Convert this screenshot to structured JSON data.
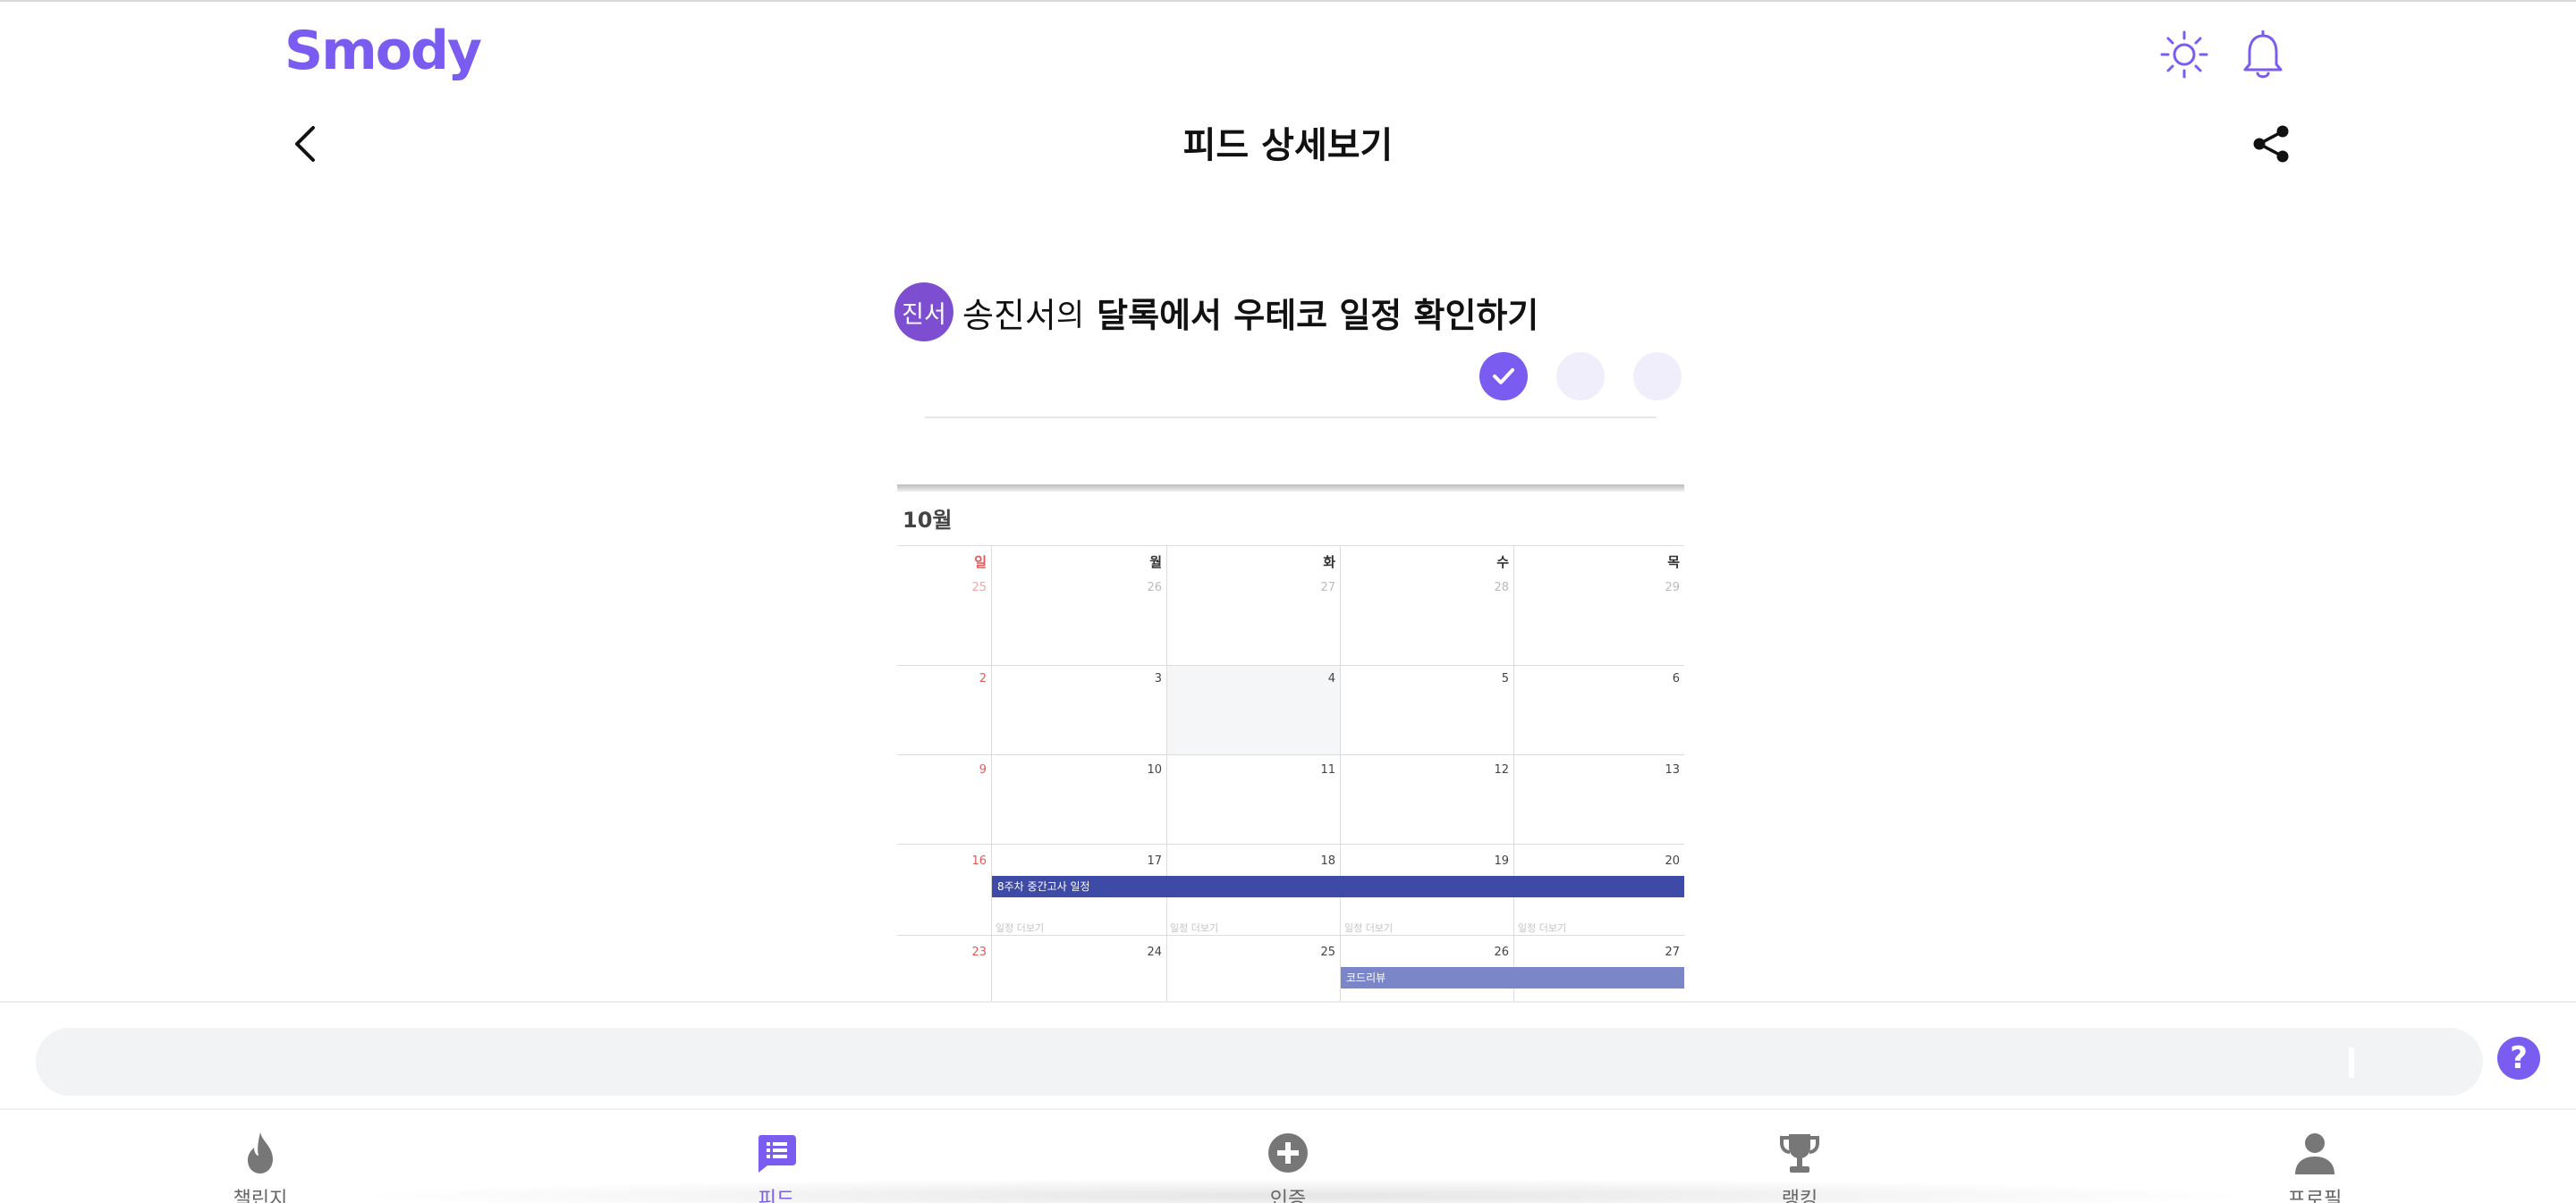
{
  "app": {
    "logo": "Smody"
  },
  "header": {
    "title": "피드 상세보기"
  },
  "feed": {
    "avatar_text": "진서",
    "author": "송진서",
    "author_suffix": "의",
    "challenge": "달록에서 우테코 일정 확인하기",
    "progress_done": 1,
    "progress_total": 3
  },
  "calendar": {
    "month": "10월",
    "weekdays": [
      "일",
      "월",
      "화",
      "수",
      "목"
    ],
    "weeks": [
      [
        "25",
        "26",
        "27",
        "28",
        "29"
      ],
      [
        "2",
        "3",
        "4",
        "5",
        "6"
      ],
      [
        "9",
        "10",
        "11",
        "12",
        "13"
      ],
      [
        "16",
        "17",
        "18",
        "19",
        "20"
      ],
      [
        "23",
        "24",
        "25",
        "26",
        "27"
      ]
    ],
    "events": [
      {
        "label": "8주차 중간고사 일정",
        "color": "#3d4aa6"
      },
      {
        "label": "코드리뷰",
        "color": "#7a86c8"
      }
    ],
    "ghost_label": "일정 더보기"
  },
  "comment": {
    "placeholder": "",
    "value": ""
  },
  "nav": {
    "items": [
      {
        "label": "챌린지",
        "icon": "fire-icon"
      },
      {
        "label": "피드",
        "icon": "feed-icon"
      },
      {
        "label": "인증",
        "icon": "plus-circle-icon"
      },
      {
        "label": "랭킹",
        "icon": "trophy-icon"
      },
      {
        "label": "프로필",
        "icon": "person-icon"
      }
    ],
    "active": "피드"
  },
  "colors": {
    "brand": "#7b5cf0",
    "highlight": "#c9bdf7",
    "progress_empty": "#f1eefc",
    "icon_gray": "#777777"
  }
}
